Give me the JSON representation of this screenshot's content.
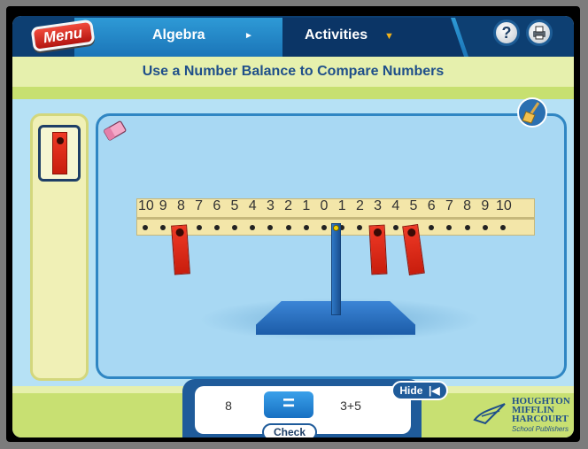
{
  "header": {
    "menu_label": "Menu",
    "tabs": [
      {
        "label": "Algebra",
        "arrow": "►"
      },
      {
        "label": "Activities",
        "arrow": "▼"
      }
    ],
    "help_label": "?",
    "print_icon": "printer-icon"
  },
  "subtitle": "Use a Number Balance to Compare Numbers",
  "tray": {
    "tile_icon": "red-weight-tile"
  },
  "tools": {
    "eraser_icon": "eraser-icon",
    "broom_icon": "broom-icon"
  },
  "balance": {
    "left_numbers": [
      "10",
      "9",
      "8",
      "7",
      "6",
      "5",
      "4",
      "3",
      "2",
      "1"
    ],
    "center": "0",
    "right_numbers": [
      "1",
      "2",
      "3",
      "4",
      "5",
      "6",
      "7",
      "8",
      "9",
      "10"
    ],
    "weights_left": [
      8
    ],
    "weights_right": [
      3,
      5
    ]
  },
  "compare": {
    "left_value": "8",
    "operator": "=",
    "right_value": "3+5",
    "check_label": "Check",
    "hide_label": "Hide"
  },
  "logo": {
    "lines": [
      "HOUGHTON",
      "MIFFLIN",
      "HARCOURT"
    ],
    "sub": "School Publishers"
  },
  "colors": {
    "accent": "#1b75b8",
    "weight": "#e32b1a",
    "panel": "#b6e1f5"
  }
}
